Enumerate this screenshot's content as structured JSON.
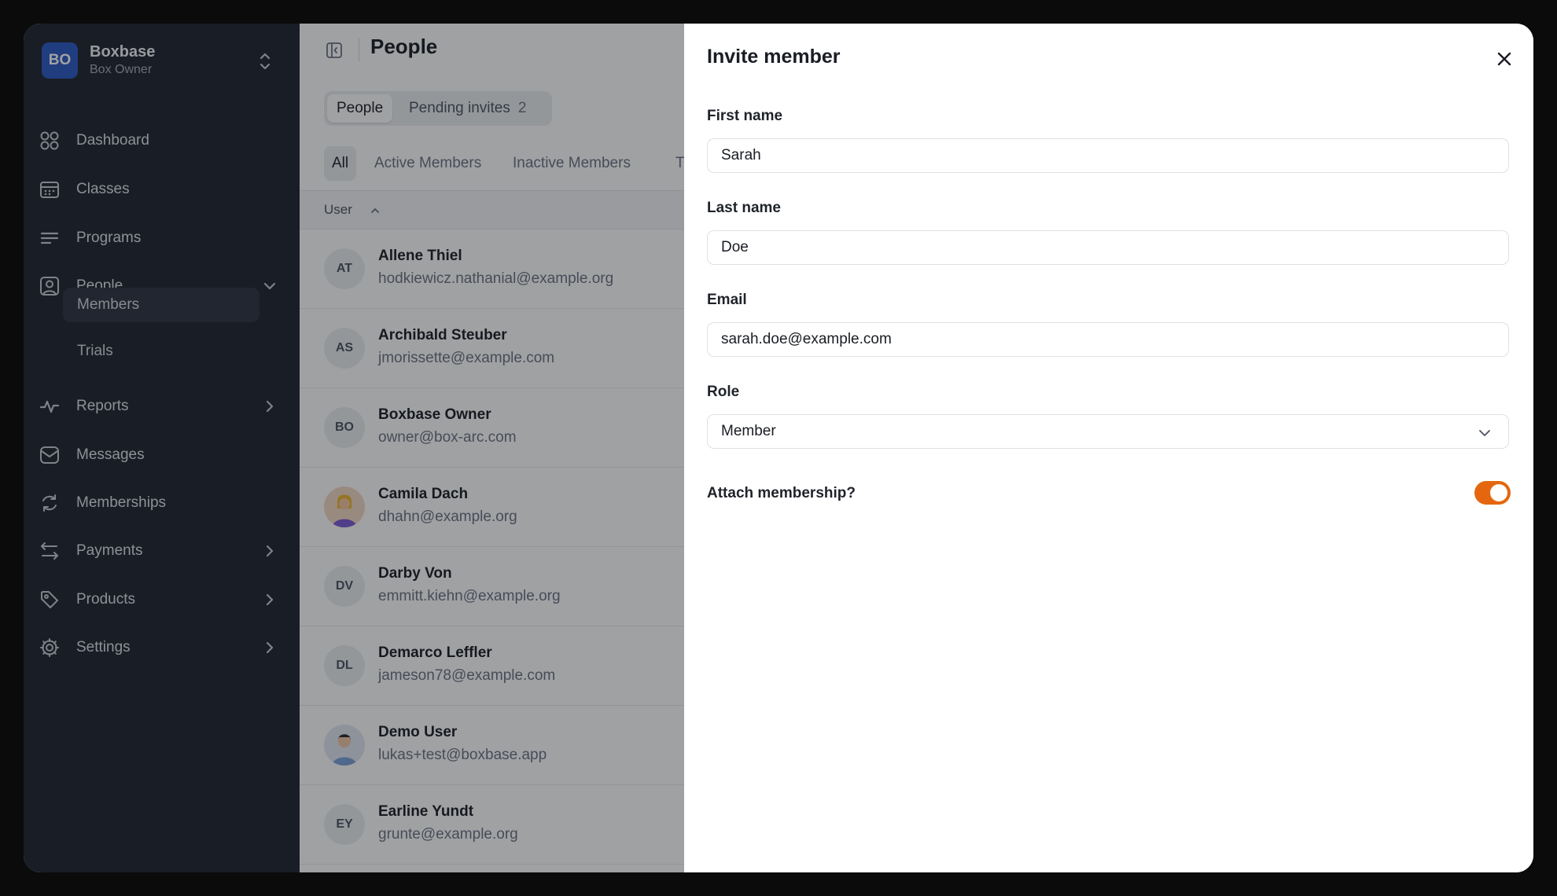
{
  "org": {
    "initials": "BO",
    "name": "Boxbase",
    "role": "Box Owner"
  },
  "nav": {
    "dashboard": "Dashboard",
    "classes": "Classes",
    "programs": "Programs",
    "people": "People",
    "members": "Members",
    "trials": "Trials",
    "reports": "Reports",
    "messages": "Messages",
    "memberships": "Memberships",
    "payments": "Payments",
    "products": "Products",
    "settings": "Settings"
  },
  "main": {
    "title": "People",
    "seg_people": "People",
    "seg_pending": "Pending invites",
    "seg_pending_count": "2",
    "filter_all": "All",
    "filter_active": "Active Members",
    "filter_inactive": "Inactive Members",
    "filter_cut": "T",
    "col_user": "User",
    "rows": [
      {
        "initials": "AT",
        "name": "Allene Thiel",
        "email": "hodkiewicz.nathanial@example.org"
      },
      {
        "initials": "AS",
        "name": "Archibald Steuber",
        "email": "jmorissette@example.com"
      },
      {
        "initials": "BO",
        "name": "Boxbase Owner",
        "email": "owner@box-arc.com"
      },
      {
        "initials": "",
        "name": "Camila Dach",
        "email": "dhahn@example.org"
      },
      {
        "initials": "DV",
        "name": "Darby Von",
        "email": "emmitt.kiehn@example.org"
      },
      {
        "initials": "DL",
        "name": "Demarco Leffler",
        "email": "jameson78@example.com"
      },
      {
        "initials": "",
        "name": "Demo User",
        "email": "lukas+test@boxbase.app"
      },
      {
        "initials": "EY",
        "name": "Earline Yundt",
        "email": "grunte@example.org"
      }
    ]
  },
  "panel": {
    "title": "Invite member",
    "first_label": "First name",
    "first_value": "Sarah",
    "last_label": "Last name",
    "last_value": "Doe",
    "email_label": "Email",
    "email_value": "sarah.doe@example.com",
    "role_label": "Role",
    "role_value": "Member",
    "attach_label": "Attach membership?",
    "attach_on": true
  },
  "colors": {
    "sidebar": "#1e2430",
    "accent": "#e4670f",
    "avatar": "#2b59c3"
  }
}
